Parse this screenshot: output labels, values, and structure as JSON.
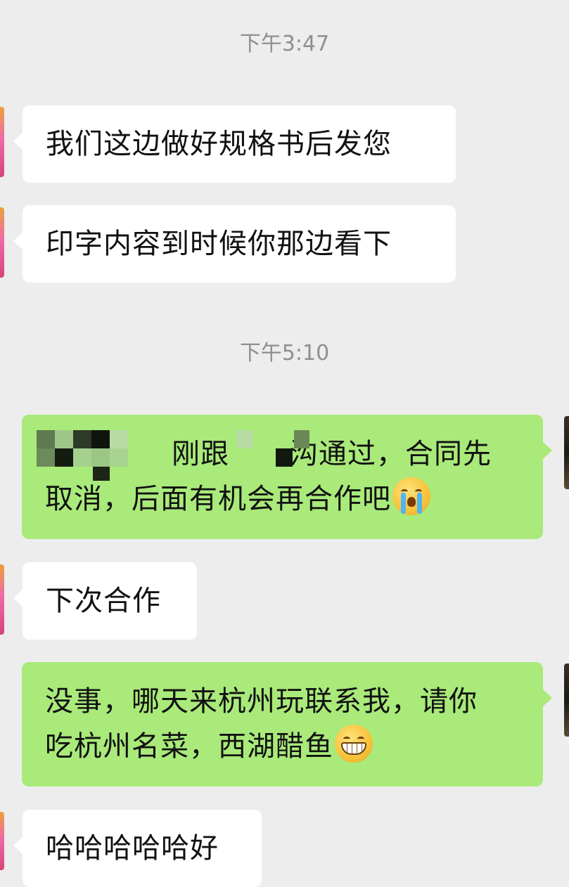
{
  "chat": {
    "timestamps": [
      "下午3:47",
      "下午5:10"
    ],
    "messages": [
      {
        "side": "in",
        "lines": [
          "我们这边做好规格书后发您"
        ]
      },
      {
        "side": "in",
        "lines": [
          "印字内容到时候你那边看下"
        ]
      },
      {
        "side": "out",
        "line1": "刚跟",
        "line1b": "沟通过，合同先",
        "line2": "取消，后面有机会再合作吧",
        "emoji": "crying-face-emoji"
      },
      {
        "side": "in",
        "lines": [
          "下次合作"
        ]
      },
      {
        "side": "out",
        "line1": "没事，哪天来杭州玩联系我，请你",
        "line2": "吃杭州名菜，西湖醋鱼",
        "emoji": "grinning-face-emoji"
      },
      {
        "side": "in",
        "lines": [
          "哈哈哈哈哈好"
        ]
      }
    ]
  },
  "colors": {
    "background": "#ededed",
    "incoming_bubble": "#ffffff",
    "outgoing_bubble": "#a9ea7a",
    "timestamp_text": "#8f8f8f"
  }
}
